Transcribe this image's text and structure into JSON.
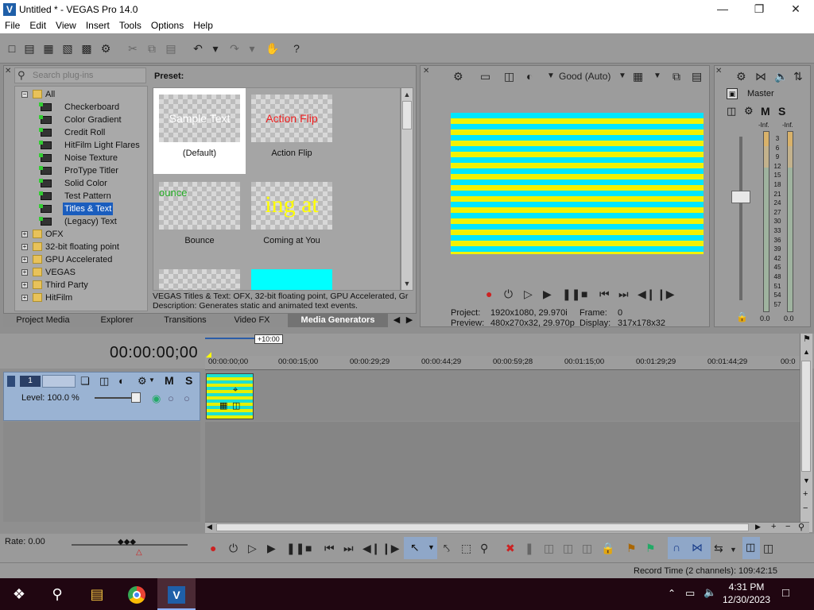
{
  "window": {
    "title": "Untitled * - VEGAS Pro 14.0",
    "logo": "V"
  },
  "menu": [
    "File",
    "Edit",
    "View",
    "Insert",
    "Tools",
    "Options",
    "Help"
  ],
  "generators": {
    "search_placeholder": "Search plug-ins",
    "preset_label": "Preset:",
    "tree": [
      {
        "label": "All",
        "type": "folder",
        "expanded": true
      },
      {
        "label": "Checkerboard",
        "type": "plugin"
      },
      {
        "label": "Color Gradient",
        "type": "plugin"
      },
      {
        "label": "Credit Roll",
        "type": "plugin"
      },
      {
        "label": "HitFilm Light Flares",
        "type": "plugin"
      },
      {
        "label": "Noise Texture",
        "type": "plugin"
      },
      {
        "label": "ProType Titler",
        "type": "plugin"
      },
      {
        "label": "Solid Color",
        "type": "plugin"
      },
      {
        "label": "Test Pattern",
        "type": "plugin"
      },
      {
        "label": "Titles & Text",
        "type": "plugin",
        "selected": true
      },
      {
        "label": "(Legacy) Text",
        "type": "plugin"
      },
      {
        "label": "OFX",
        "type": "folder"
      },
      {
        "label": "32-bit floating point",
        "type": "folder"
      },
      {
        "label": "GPU Accelerated",
        "type": "folder"
      },
      {
        "label": "VEGAS",
        "type": "folder"
      },
      {
        "label": "Third Party",
        "type": "folder"
      },
      {
        "label": "HitFilm",
        "type": "folder"
      }
    ],
    "presets": [
      {
        "label": "(Default)",
        "thumb_text": "Sample Text",
        "selected": true
      },
      {
        "label": "Action Flip",
        "thumb_text": "Action Flip"
      },
      {
        "label": "Bounce",
        "thumb_text": "ounce"
      },
      {
        "label": "Coming at You",
        "thumb_text": "ing at"
      }
    ],
    "description_line1": "VEGAS Titles & Text: OFX, 32-bit floating point, GPU Accelerated, Gr",
    "description_line2": "Description: Generates static and animated text events.",
    "tabs": [
      "Project Media",
      "Explorer",
      "Transitions",
      "Video FX",
      "Media Generators"
    ],
    "active_tab": "Media Generators"
  },
  "preview": {
    "quality": "Good (Auto)",
    "project_label": "Project:",
    "project_value": "1920x1080, 29.970i",
    "frame_label": "Frame:",
    "frame_value": "0",
    "preview_label": "Preview:",
    "preview_value": "480x270x32, 29.970p",
    "display_label": "Display:",
    "display_value": "317x178x32"
  },
  "mixer": {
    "title": "Master",
    "m": "M",
    "s": "S",
    "inf_l": "-Inf.",
    "inf_r": "-Inf.",
    "scale": [
      "3",
      "6",
      "9",
      "12",
      "15",
      "18",
      "21",
      "24",
      "27",
      "30",
      "33",
      "36",
      "39",
      "42",
      "45",
      "48",
      "51",
      "54",
      "57"
    ],
    "bottom_l": "0.0",
    "bottom_r": "0.0"
  },
  "timeline": {
    "timecode": "00:00:00;00",
    "offset": "+10:00",
    "ruler": [
      "00:00:00;00",
      "00:00:15;00",
      "00:00:29;29",
      "00:00:44;29",
      "00:00:59;28",
      "00:01:15;00",
      "00:01:29;29",
      "00:01:44;29",
      "00:0"
    ],
    "track_number": "1",
    "track_m": "M",
    "track_s": "S",
    "level": "Level: 100.0 %",
    "rate": "Rate: 0.00",
    "record_time": "Record Time (2 channels): 109:42:15"
  },
  "taskbar": {
    "time": "4:31 PM",
    "date": "12/30/2023"
  }
}
